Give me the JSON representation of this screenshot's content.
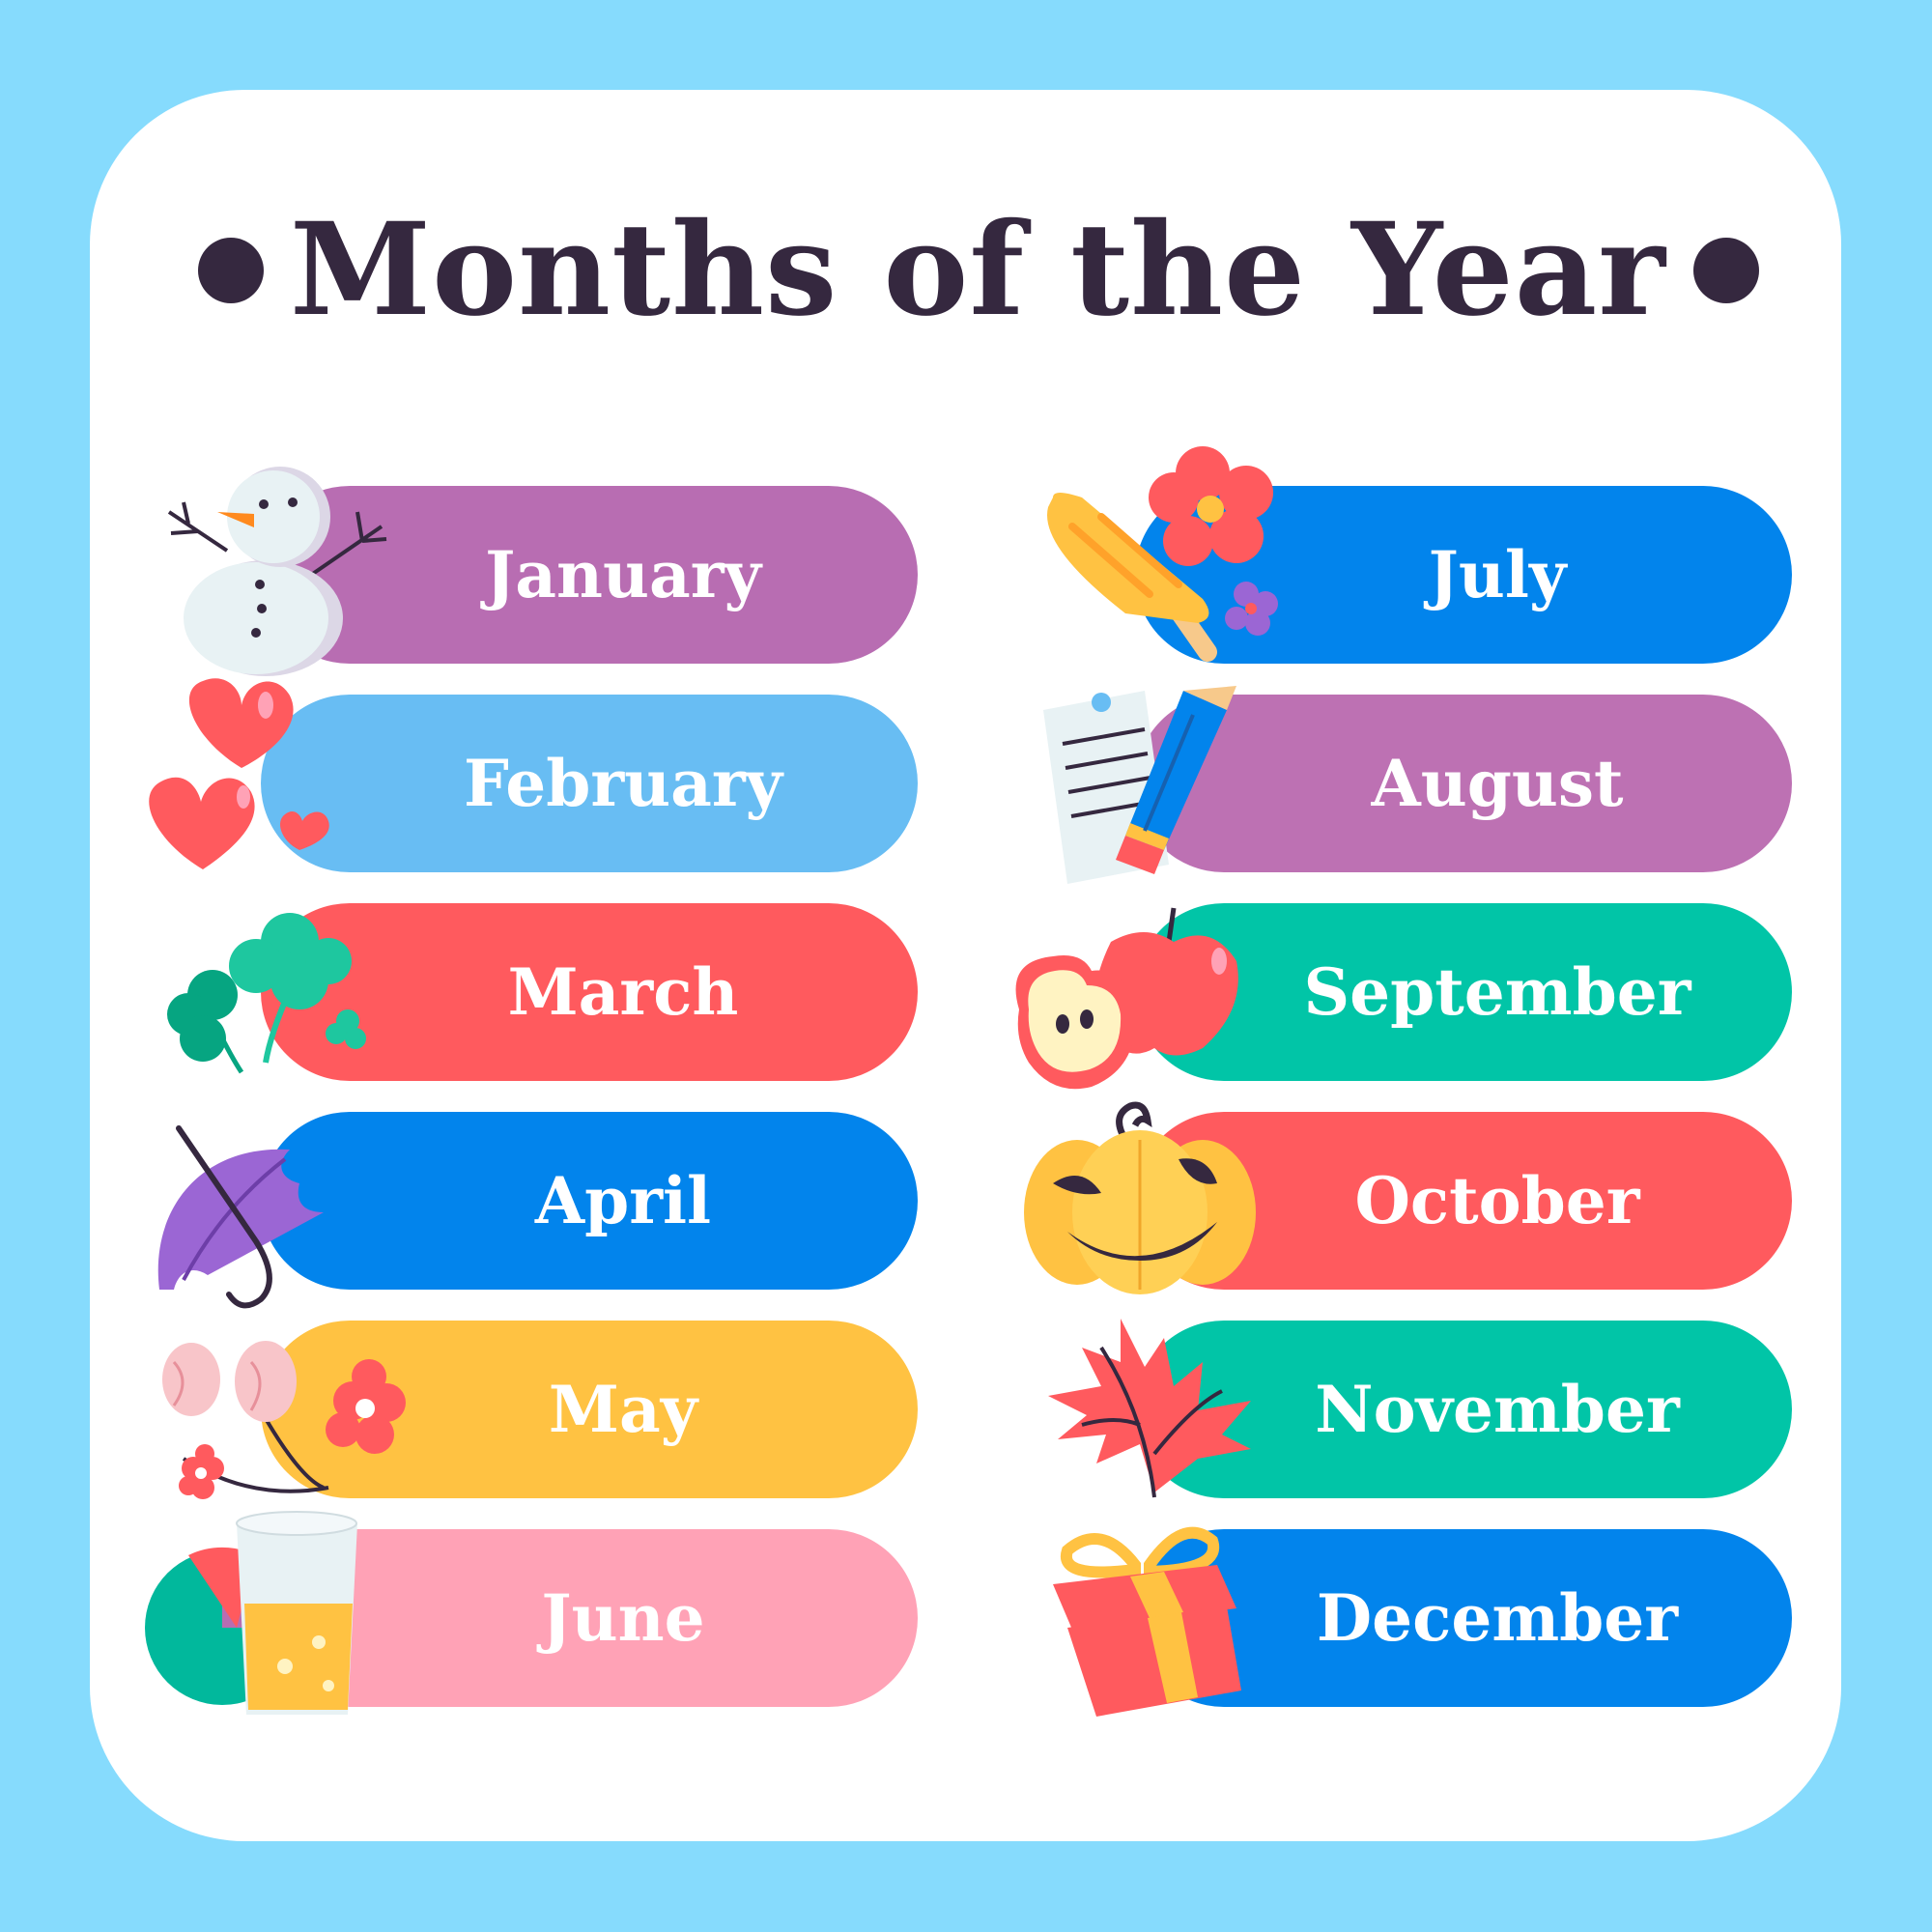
{
  "title": "Months of the Year",
  "colors": {
    "background": "#86dbfd",
    "card": "#ffffff",
    "title_text": "#35283f",
    "purple": "#b86db2",
    "light_blue": "#68bdf3",
    "red": "#ff5a5e",
    "blue": "#0284ec",
    "yellow": "#ffc242",
    "pink": "#ffa2b6",
    "teal": "#01c5a7"
  },
  "months": [
    {
      "label": "January",
      "color": "#b86db2",
      "icon": "snowman-icon"
    },
    {
      "label": "February",
      "color": "#68bdf3",
      "icon": "hearts-icon"
    },
    {
      "label": "March",
      "color": "#ff5a5e",
      "icon": "clover-icon"
    },
    {
      "label": "April",
      "color": "#0284ec",
      "icon": "umbrella-icon"
    },
    {
      "label": "May",
      "color": "#ffc242",
      "icon": "flowers-icon"
    },
    {
      "label": "June",
      "color": "#ffa2b6",
      "icon": "juice-and-ball-icon"
    },
    {
      "label": "July",
      "color": "#0284ec",
      "icon": "popsicle-icon"
    },
    {
      "label": "August",
      "color": "#bd71b3",
      "icon": "pencil-and-note-icon"
    },
    {
      "label": "September",
      "color": "#01c5a7",
      "icon": "apple-icon"
    },
    {
      "label": "October",
      "color": "#ff5a5e",
      "icon": "pumpkin-icon"
    },
    {
      "label": "November",
      "color": "#01c5a7",
      "icon": "autumn-leaf-icon"
    },
    {
      "label": "December",
      "color": "#0284ec",
      "icon": "gift-icon"
    }
  ]
}
